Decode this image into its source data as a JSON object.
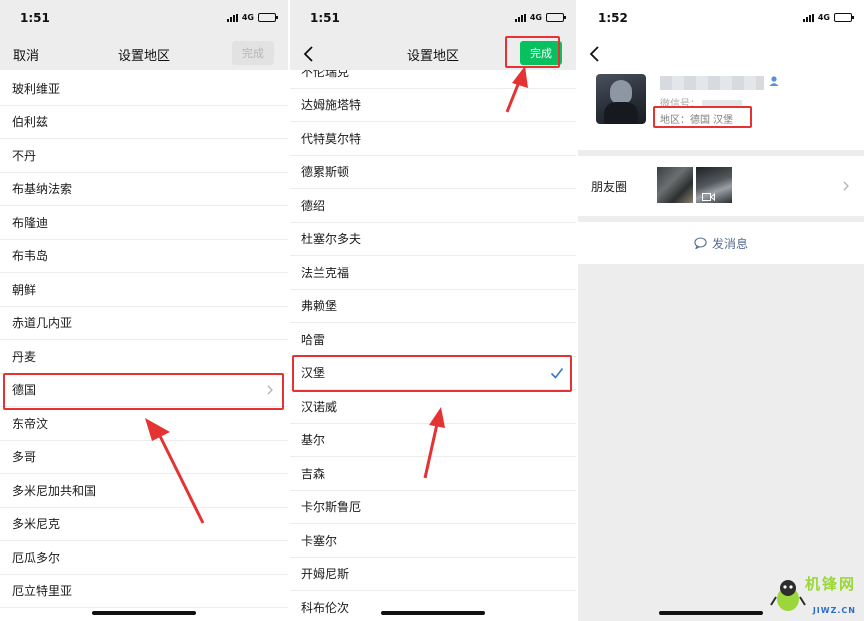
{
  "panel1": {
    "status": {
      "time": "1:51",
      "network": "4G"
    },
    "nav": {
      "cancel": "取消",
      "title": "设置地区",
      "done": "完成"
    },
    "items": [
      "玻利维亚",
      "伯利兹",
      "不丹",
      "布基纳法索",
      "布隆迪",
      "布韦岛",
      "朝鲜",
      "赤道几内亚",
      "丹麦",
      "德国",
      "东帝汶",
      "多哥",
      "多米尼加共和国",
      "多米尼克",
      "厄瓜多尔",
      "厄立特里亚"
    ],
    "selected_index": 9
  },
  "panel2": {
    "status": {
      "time": "1:51",
      "network": "4G"
    },
    "nav": {
      "title": "设置地区",
      "done": "完成"
    },
    "items": [
      "不伦瑞克",
      "达姆施塔特",
      "代特莫尔特",
      "德累斯顿",
      "德绍",
      "杜塞尔多夫",
      "法兰克福",
      "弗赖堡",
      "哈雷",
      "汉堡",
      "汉诺威",
      "基尔",
      "吉森",
      "卡尔斯鲁厄",
      "卡塞尔",
      "开姆尼斯",
      "科布伦次"
    ],
    "checked_index": 9
  },
  "panel3": {
    "status": {
      "time": "1:52",
      "network": "4G"
    },
    "profile": {
      "wxid_label": "微信号：",
      "region": "地区：德国 汉堡"
    },
    "moments_label": "朋友圈",
    "send_message": "发消息"
  },
  "watermark": {
    "text": "机锋网",
    "url": "JIWZ.CN"
  },
  "colors": {
    "highlight": "#e53333",
    "wechat_green": "#07c160",
    "link_blue": "#576b95",
    "check_blue": "#2f7bd9"
  }
}
